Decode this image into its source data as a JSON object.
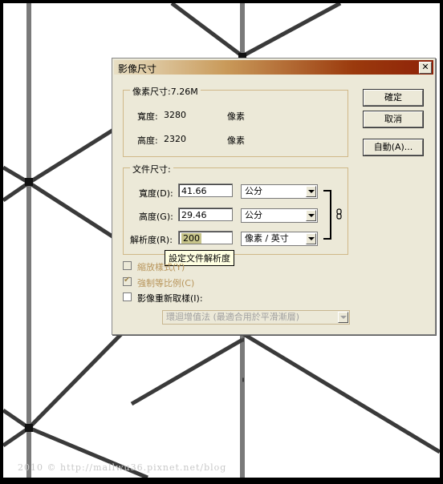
{
  "dialog": {
    "title": "影像尺寸",
    "close_label": "✕"
  },
  "pixel_dimensions": {
    "legend": "像素尺寸:7.26M",
    "width_label": "寬度:",
    "width_value": "3280",
    "width_unit": "像素",
    "height_label": "高度:",
    "height_value": "2320",
    "height_unit": "像素"
  },
  "document_size": {
    "legend": "文件尺寸:",
    "width_label": "寬度(D):",
    "width_value": "41.66",
    "width_unit": "公分",
    "height_label": "高度(G):",
    "height_value": "29.46",
    "height_unit": "公分",
    "resolution_label": "解析度(R):",
    "resolution_value": "200",
    "resolution_unit": "像素 / 英寸",
    "tooltip": "設定文件解析度"
  },
  "buttons": {
    "ok": "確定",
    "cancel": "取消",
    "auto": "自動(A)..."
  },
  "options": {
    "scale_styles": {
      "label": "縮放樣式(Y)",
      "checked": false,
      "enabled": false
    },
    "constrain": {
      "label": "強制等比例(C)",
      "checked": true,
      "enabled": false
    },
    "resample": {
      "label": "影像重新取樣(I):",
      "checked": false,
      "enabled": true
    },
    "resample_method": "環迴增值法 (最適合用於平滑漸層)"
  },
  "watermark": "2010 © http://mallwu36.pixnet.net/blog",
  "colors": {
    "title_gradient_end": "#8e2208",
    "group_border": "#d0b888",
    "disabled_text": "#b8955b"
  }
}
